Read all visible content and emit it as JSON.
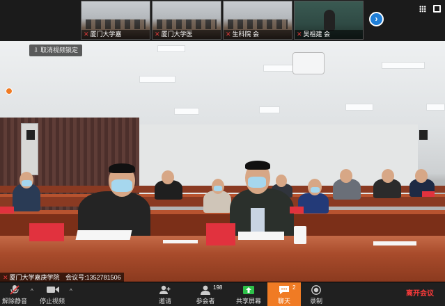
{
  "thumbnails": [
    {
      "caption": "厦门大学嘉"
    },
    {
      "caption": "厦门大学医"
    },
    {
      "caption": "生科院  会"
    },
    {
      "caption": "吴祖建  会"
    }
  ],
  "video": {
    "unlock_button": "取消视频锁定"
  },
  "meeting_info": {
    "name": "厦门大学嘉庚学院",
    "id_label": "会议号:",
    "id_value": "1352781506"
  },
  "toolbar": {
    "mute_label": "解除静音",
    "video_label": "停止视频",
    "invite_label": "邀请",
    "participants_label": "参会者",
    "participants_count": "198",
    "share_label": "共享屏幕",
    "chat_label": "聊天",
    "chat_count": "2",
    "record_label": "录制",
    "leave_label": "离开会议"
  },
  "colors": {
    "accent": "#f07b24",
    "leave": "#ff3b3b",
    "share": "#2ec24a",
    "next": "#1f7fd8"
  },
  "icons": [
    "mic-muted-icon",
    "camera-icon",
    "add-user-icon",
    "people-icon",
    "share-screen-icon",
    "chat-icon",
    "record-icon",
    "chevron-right-icon",
    "grid-icon",
    "fullscreen-icon",
    "lock-icon"
  ]
}
